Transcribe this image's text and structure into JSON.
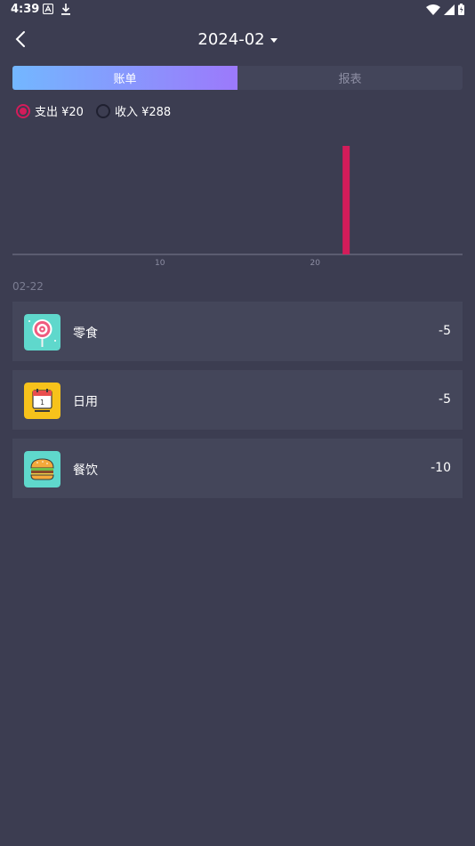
{
  "status": {
    "time": "4:39"
  },
  "header": {
    "title": "2024-02"
  },
  "tabs": [
    {
      "label": "账单",
      "active": true
    },
    {
      "label": "报表",
      "active": false
    }
  ],
  "filters": {
    "expense": {
      "label": "支出 ¥20",
      "selected": true
    },
    "income": {
      "label": "收入 ¥288",
      "selected": false
    }
  },
  "chart_data": {
    "type": "bar",
    "x": [
      22
    ],
    "values": [
      20
    ],
    "xlim": [
      1,
      29
    ],
    "xticks": [
      "10",
      "20"
    ],
    "bar_color": "#d31c5a"
  },
  "date_group": "02-22",
  "records": [
    {
      "name": "零食",
      "amount": "-5",
      "icon": "lollipop-icon",
      "icon_bg": "#5fd8cc"
    },
    {
      "name": "日用",
      "amount": "-5",
      "icon": "calendar-icon",
      "icon_bg": "#f7c21b"
    },
    {
      "name": "餐饮",
      "amount": "-10",
      "icon": "burger-icon",
      "icon_bg": "#5fd8cc"
    }
  ],
  "colors": {
    "background": "#3c3d51",
    "card": "#44465a",
    "accent": "#d31c5a",
    "tab_gradient_start": "#73b7ff",
    "tab_gradient_end": "#9c79fb"
  }
}
